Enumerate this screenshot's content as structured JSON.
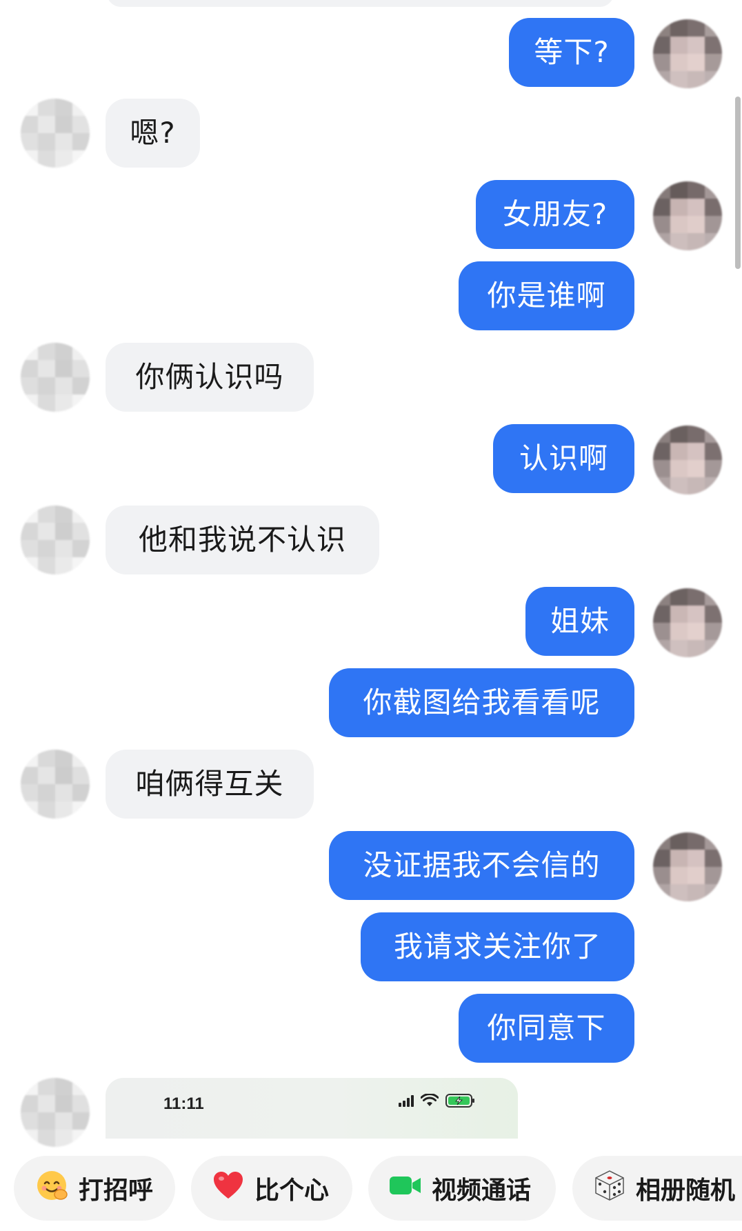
{
  "messages": [
    {
      "side": "out",
      "text": "等下?"
    },
    {
      "side": "in",
      "text": "嗯?"
    },
    {
      "side": "out",
      "text": "女朋友?"
    },
    {
      "side": "out",
      "text": "你是谁啊"
    },
    {
      "side": "in",
      "text": "你俩认识吗"
    },
    {
      "side": "out",
      "text": "认识啊"
    },
    {
      "side": "in",
      "text": "他和我说不认识"
    },
    {
      "side": "out",
      "text": "姐妹"
    },
    {
      "side": "out",
      "text": "你截图给我看看呢"
    },
    {
      "side": "in",
      "text": "咱俩得互关"
    },
    {
      "side": "out",
      "text": "没证据我不会信的"
    },
    {
      "side": "out",
      "text": "我请求关注你了"
    },
    {
      "side": "out",
      "text": "你同意下"
    }
  ],
  "screenshot_preview": {
    "time": "11:11"
  },
  "quick_actions": [
    {
      "label": "打招呼",
      "icon": "wave-emoji-icon"
    },
    {
      "label": "比个心",
      "icon": "heart-icon"
    },
    {
      "label": "视频通话",
      "icon": "video-camera-icon"
    },
    {
      "label": "相册随机",
      "icon": "dice-icon"
    }
  ],
  "colors": {
    "outgoing_bubble": "#2f75f4",
    "incoming_bubble": "#f1f2f4",
    "video_icon": "#1fc65a",
    "heart_icon": "#ef3340"
  }
}
